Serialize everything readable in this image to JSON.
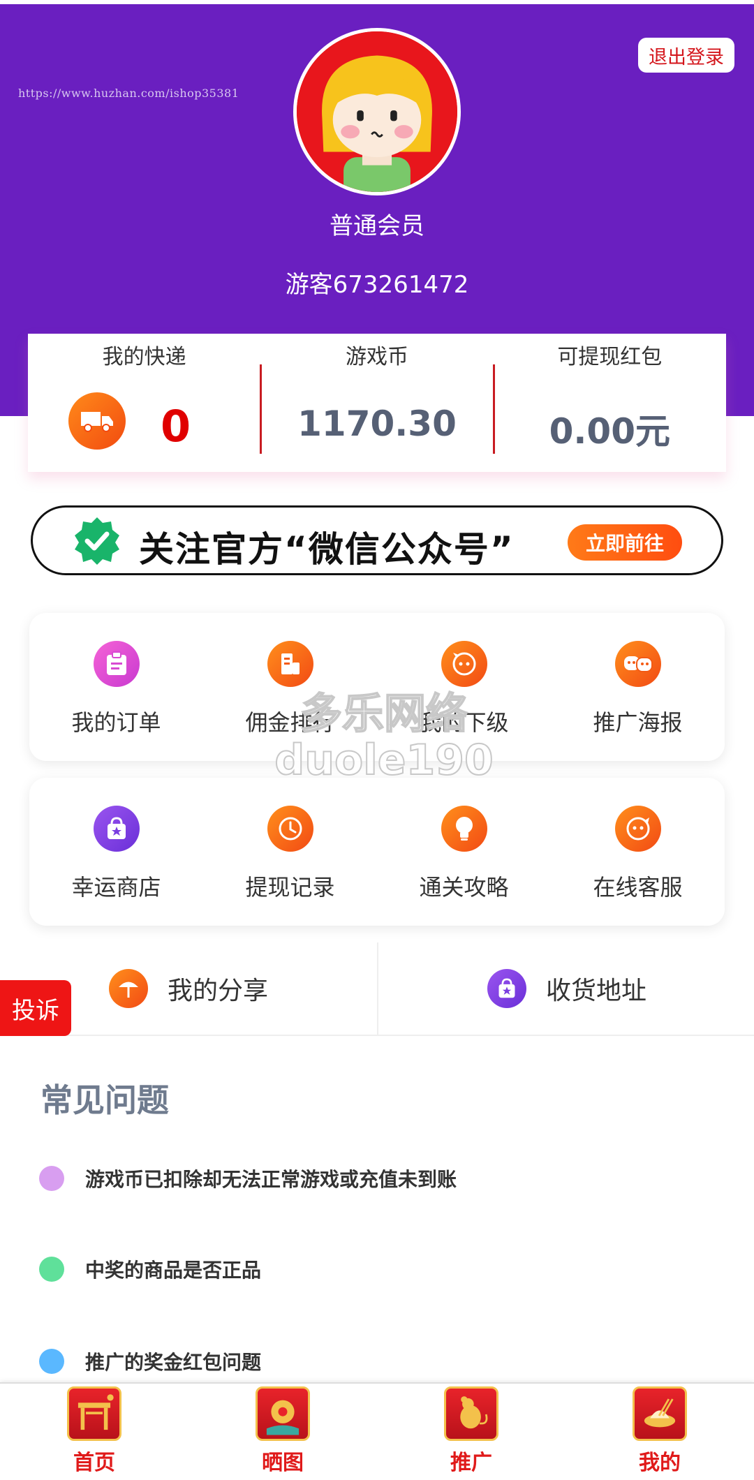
{
  "header": {
    "watermark_url": "https://www.huzhan.com/ishop35381",
    "logout_label": "退出登录",
    "member_level": "普通会员",
    "username": "游客673261472",
    "background_color": "#6a1fc0"
  },
  "stats": {
    "delivery": {
      "label": "我的快递",
      "value": "0",
      "icon": "truck-icon"
    },
    "coins": {
      "label": "游戏币",
      "value": "1170.30"
    },
    "redpacket": {
      "label": "可提现红包",
      "value": "0.00元"
    }
  },
  "banner": {
    "text": "关注官方“微信公众号”",
    "button_label": "立即前往",
    "icon": "verified-badge-icon"
  },
  "menu_row1": [
    {
      "label": "我的订单",
      "icon": "clipboard-icon"
    },
    {
      "label": "佣金排行",
      "icon": "ranking-icon"
    },
    {
      "label": "我的下级",
      "icon": "chat-bubble-icon"
    },
    {
      "label": "推广海报",
      "icon": "two-faces-icon"
    }
  ],
  "menu_row2": [
    {
      "label": "幸运商店",
      "icon": "shopping-bag-icon"
    },
    {
      "label": "提现记录",
      "icon": "clock-icon"
    },
    {
      "label": "通关攻略",
      "icon": "lightbulb-icon"
    },
    {
      "label": "在线客服",
      "icon": "smiley-icon"
    }
  ],
  "watermark_overlay": {
    "line1": "多乐网络",
    "line2": "duole190"
  },
  "share": {
    "label": "我的分享",
    "icon": "umbrella-icon"
  },
  "address": {
    "label": "收货地址",
    "icon": "shopping-bag-icon"
  },
  "complaint_label": "投诉",
  "faq": {
    "title": "常见问题",
    "items": [
      {
        "text": "游戏币已扣除却无法正常游戏或充值未到账",
        "color": "#d89ef0"
      },
      {
        "text": "中奖的商品是否正品",
        "color": "#5fe09a"
      },
      {
        "text": "推广的奖金红包问题",
        "color": "#5ab8ff"
      }
    ]
  },
  "bottom_nav": [
    {
      "label": "首页",
      "icon": "gate-icon"
    },
    {
      "label": "晒图",
      "icon": "flower-icon"
    },
    {
      "label": "推广",
      "icon": "rat-icon"
    },
    {
      "label": "我的",
      "icon": "dumpling-icon"
    }
  ],
  "colors": {
    "accent_red": "#e01a1a",
    "orange": "#ff6a14",
    "purple": "#6a1fc0",
    "value_gray": "#566075"
  }
}
